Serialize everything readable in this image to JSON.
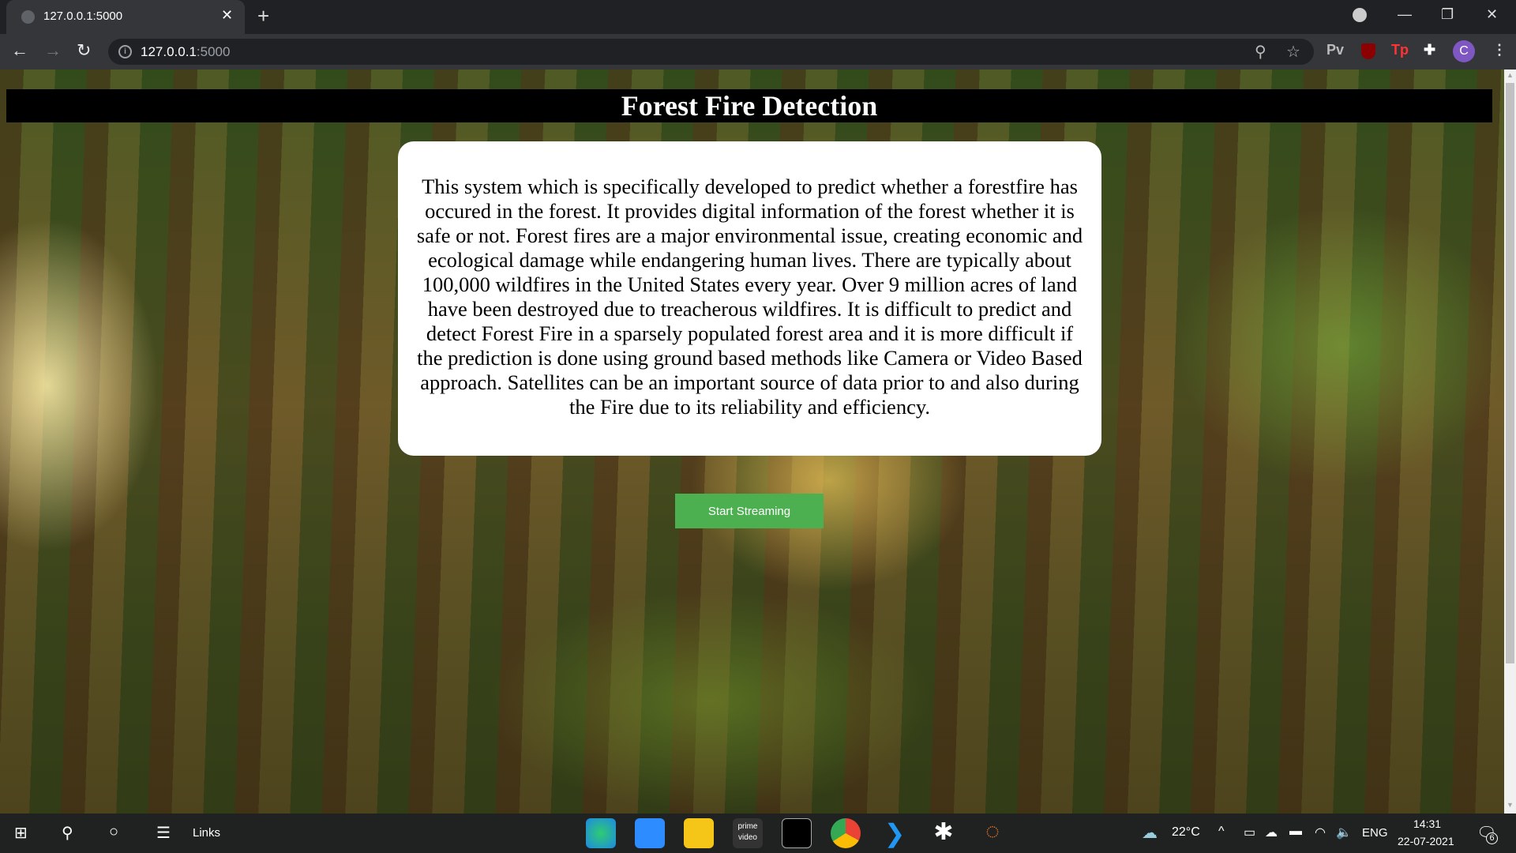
{
  "browser": {
    "tab_title": "127.0.0.1:5000",
    "url_host": "127.0.0.1",
    "url_port": ":5000",
    "extensions": [
      "Pv",
      "uBlock",
      "Tp",
      "extensions"
    ],
    "profile_initial": "C"
  },
  "page": {
    "title": "Forest Fire Detection",
    "description": "This system which is specifically developed to predict whether a forestfire has occured in the forest. It provides digital information of the forest whether it is safe or not. Forest fires are a major environmental issue, creating economic and ecological damage while endangering human lives. There are typically about 100,000 wildfires in the United States every year. Over 9 million acres of land have been destroyed due to treacherous wildfires. It is difficult to predict and detect Forest Fire in a sparsely populated forest area and it is more difficult if the prediction is done using ground based methods like Camera or Video Based approach. Satellites can be an important source of data prior to and also during the Fire due to its reliability and efficiency.",
    "button_label": "Start Streaming",
    "button_color": "#4caf50"
  },
  "taskbar": {
    "links_label": "Links",
    "apps": [
      "Edge",
      "Zoom",
      "File Explorer",
      "Prime Video",
      "Terminal",
      "Chrome",
      "VS Code",
      "Spider app",
      "Jupyter"
    ],
    "weather": "22°C",
    "language": "ENG",
    "time": "14:31",
    "date": "22-07-2021",
    "notifications": "6"
  }
}
